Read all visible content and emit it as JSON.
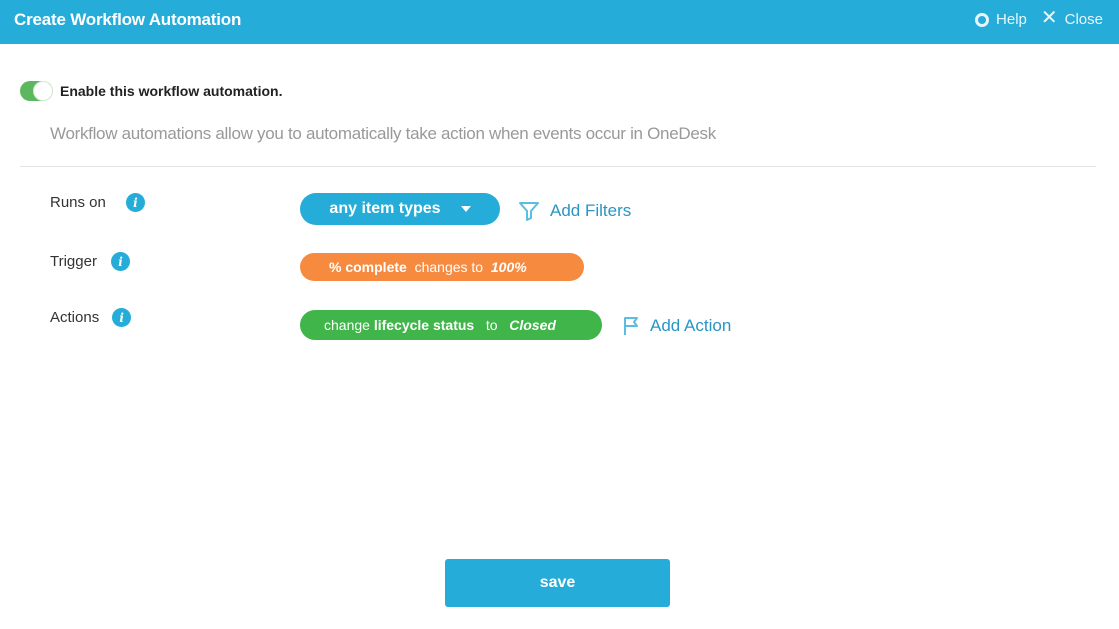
{
  "header": {
    "title": "Create Workflow Automation",
    "help_label": "Help",
    "close_label": "Close"
  },
  "enable": {
    "on": true,
    "label": "Enable this workflow automation."
  },
  "description": "Workflow automations allow you to automatically take action when events occur in OneDesk",
  "runs_on": {
    "label": "Runs on",
    "selected": "any item types",
    "add_filters_label": "Add Filters"
  },
  "trigger": {
    "label": "Trigger",
    "field": "% complete",
    "verb": "changes to",
    "value": "100%"
  },
  "actions": {
    "label": "Actions",
    "verb": "change",
    "field": "lifecycle status",
    "connector": "to",
    "value": "Closed",
    "add_action_label": "Add Action"
  },
  "save_label": "save",
  "colors": {
    "header": "#25acd8",
    "trigger": "#f68b40",
    "action": "#40b549",
    "toggle_on": "#5cb85c"
  }
}
